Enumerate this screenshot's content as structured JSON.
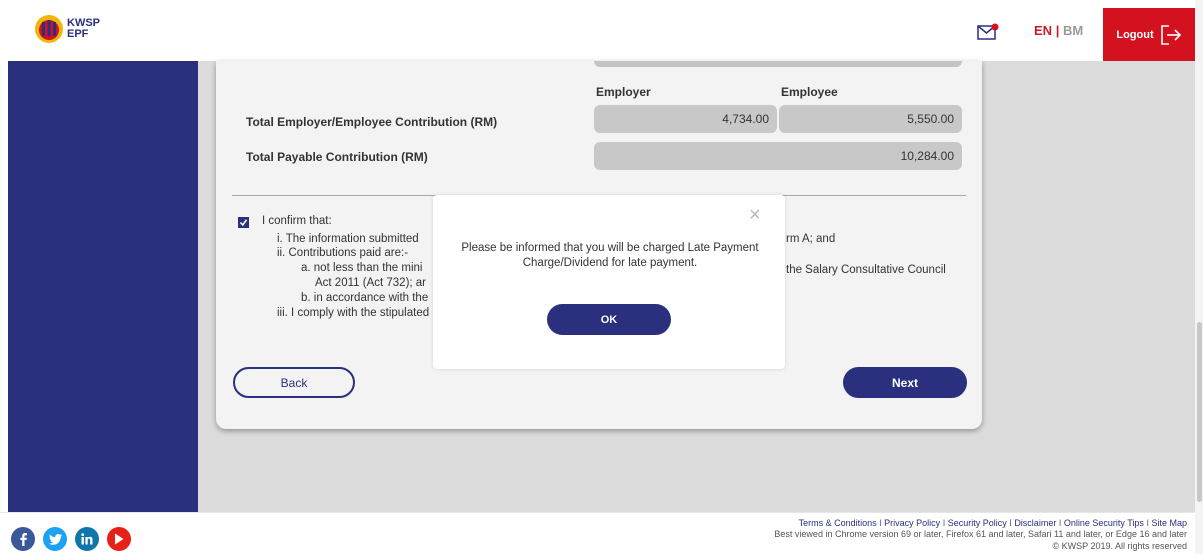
{
  "header": {
    "logo_top": "KWSP",
    "logo_bottom": "EPF",
    "lang_en": "EN",
    "lang_sep": "|",
    "lang_bm": "BM",
    "logout_label": "Logout"
  },
  "contribution": {
    "employer_heading": "Employer",
    "employee_heading": "Employee",
    "total_row_label": "Total Employer/Employee Contribution (RM)",
    "employer_value": "4,734.00",
    "employee_value": "5,550.00",
    "payable_row_label": "Total Payable Contribution (RM)",
    "payable_value": "10,284.00"
  },
  "confirmation": {
    "checked": true,
    "lead": "I confirm that:",
    "line_i": "i. The information submitted",
    "line_i_tail": "rm A; and",
    "line_ii": "ii. Contributions paid are:-",
    "line_ii_a": "a. not less than the mini",
    "line_ii_a_tail": "the Salary Consultative Council",
    "line_ii_a_cont": "Act 2011 (Act 732); ar",
    "line_ii_b": "b. in accordance with the",
    "line_iii": "iii. I comply with the stipulated"
  },
  "actions": {
    "back_label": "Back",
    "next_label": "Next"
  },
  "modal": {
    "close_glyph": "×",
    "message": "Please be informed that you will be charged Late Payment Charge/Dividend for late payment.",
    "ok_label": "OK"
  },
  "footer": {
    "links": [
      "Terms & Conditions",
      "Privacy Policy",
      "Security Policy",
      "Disclaimer",
      "Online Security Tips",
      "Site Map"
    ],
    "link_separator": "I",
    "browser_note": "Best viewed in Chrome version 69 or later, Firefox 61 and later, Safari 11 and later, or Edge 16 and later",
    "copyright": "© KWSP 2019. All rights reserved",
    "social_icons": [
      "facebook-icon",
      "twitter-icon",
      "linkedin-icon",
      "youtube-icon"
    ]
  },
  "colors": {
    "brand_navy": "#2a2f7e",
    "logout_red": "#d3111f",
    "facebook": "#3b5998",
    "twitter": "#1da1f2",
    "linkedin": "#0e76a8",
    "youtube": "#e62117"
  }
}
